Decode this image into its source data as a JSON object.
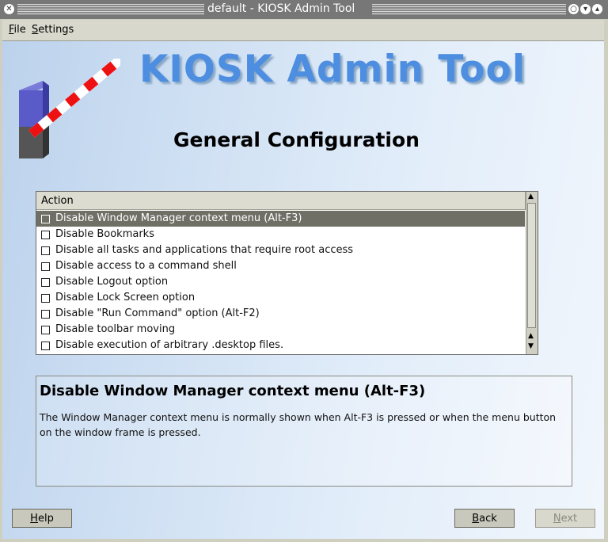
{
  "window": {
    "title": "default - KIOSK Admin Tool",
    "controls": [
      "menu-circle-icon",
      "minimize-icon",
      "close-icon"
    ]
  },
  "menubar": {
    "items": [
      {
        "label": "File",
        "mnemonic": "F",
        "rest": "ile"
      },
      {
        "label": "Settings",
        "mnemonic": "S",
        "rest": "ettings"
      }
    ]
  },
  "banner": {
    "title": "KIOSK Admin Tool",
    "subtitle": "General Configuration",
    "title_color": "#4d8ee0"
  },
  "list": {
    "header": "Action",
    "rows": [
      {
        "label": "Disable Window Manager context menu (Alt-F3)",
        "checked": false,
        "selected": true
      },
      {
        "label": "Disable Bookmarks",
        "checked": false,
        "selected": false
      },
      {
        "label": "Disable all tasks and applications that require root access",
        "checked": false,
        "selected": false
      },
      {
        "label": "Disable access to a command shell",
        "checked": false,
        "selected": false
      },
      {
        "label": "Disable Logout option",
        "checked": false,
        "selected": false
      },
      {
        "label": "Disable Lock Screen option",
        "checked": false,
        "selected": false
      },
      {
        "label": "Disable \"Run Command\" option (Alt-F2)",
        "checked": false,
        "selected": false
      },
      {
        "label": "Disable toolbar moving",
        "checked": false,
        "selected": false
      },
      {
        "label": "Disable execution of arbitrary .desktop files.",
        "checked": false,
        "selected": false
      }
    ]
  },
  "description": {
    "title": "Disable Window Manager context menu (Alt-F3)",
    "text": "The Window Manager context menu is normally shown when Alt-F3 is pressed or when the menu button on the window frame is pressed."
  },
  "buttons": {
    "help": {
      "mnemonic": "H",
      "rest": "elp"
    },
    "back": {
      "mnemonic": "B",
      "rest": "ack"
    },
    "next": {
      "mnemonic": "N",
      "rest": "ext",
      "enabled": false
    }
  }
}
